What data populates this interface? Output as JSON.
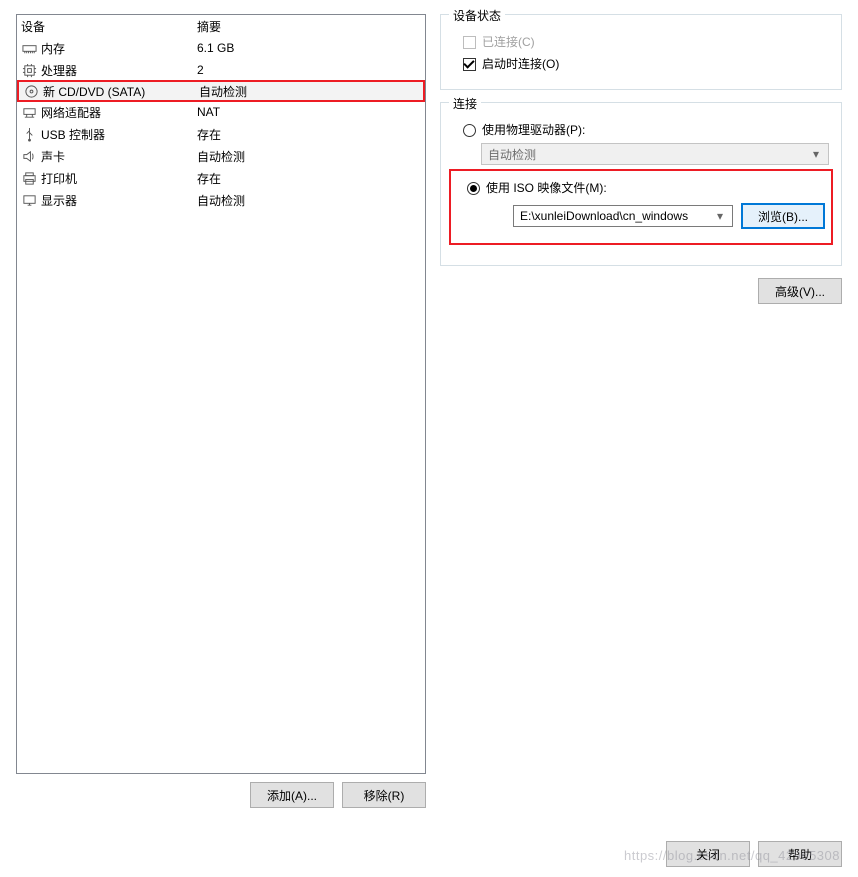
{
  "device_list": {
    "header_device": "设备",
    "header_summary": "摘要",
    "rows": [
      {
        "icon": "memory-icon",
        "name": "内存",
        "summary": "6.1 GB",
        "selected": false
      },
      {
        "icon": "cpu-icon",
        "name": "处理器",
        "summary": "2",
        "selected": false
      },
      {
        "icon": "disc-icon",
        "name": "新 CD/DVD (SATA)",
        "summary": "自动检测",
        "selected": true
      },
      {
        "icon": "network-icon",
        "name": "网络适配器",
        "summary": "NAT",
        "selected": false
      },
      {
        "icon": "usb-icon",
        "name": "USB 控制器",
        "summary": "存在",
        "selected": false
      },
      {
        "icon": "sound-icon",
        "name": "声卡",
        "summary": "自动检测",
        "selected": false
      },
      {
        "icon": "printer-icon",
        "name": "打印机",
        "summary": "存在",
        "selected": false
      },
      {
        "icon": "display-icon",
        "name": "显示器",
        "summary": "自动检测",
        "selected": false
      }
    ]
  },
  "buttons": {
    "add": "添加(A)...",
    "remove": "移除(R)",
    "browse": "浏览(B)...",
    "advanced": "高级(V)...",
    "close": "关闭",
    "help": "帮助"
  },
  "device_status": {
    "title": "设备状态",
    "connected_label": "已连接(C)",
    "connected": false,
    "connect_at_power_on_label": "启动时连接(O)",
    "connect_at_power_on": true
  },
  "connection": {
    "title": "连接",
    "use_physical_label": "使用物理驱动器(P):",
    "physical_selected": "自动检测",
    "use_iso_label": "使用 ISO 映像文件(M):",
    "iso_path": "E:\\xunleiDownload\\cn_windows",
    "selected_mode": "iso"
  },
  "watermark": "https://blog.csdn.net/qq_42965308"
}
